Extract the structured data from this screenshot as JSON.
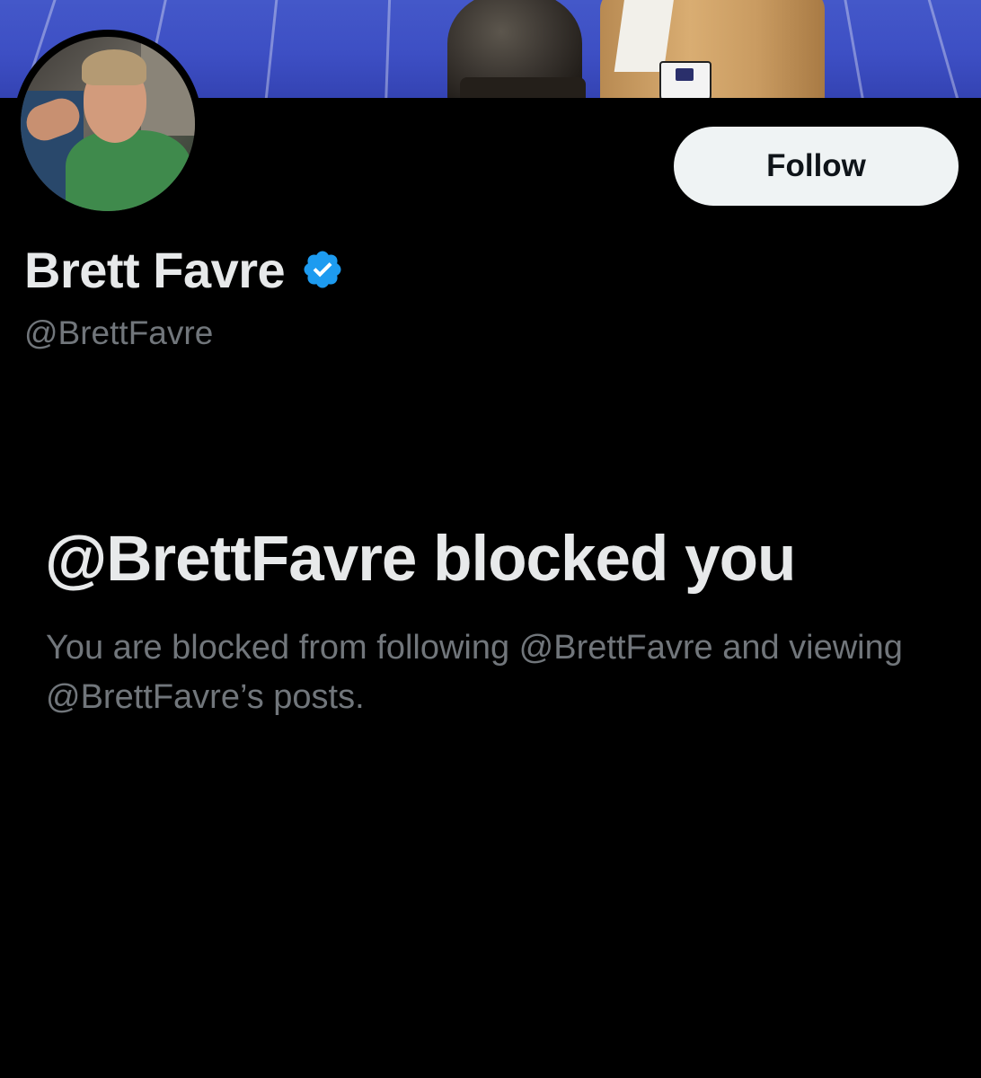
{
  "profile": {
    "display_name": "Brett Favre",
    "handle": "@BrettFavre",
    "verified": true,
    "verified_icon": "verified-badge-icon",
    "verified_color": "#1d9bf0"
  },
  "actions": {
    "follow_label": "Follow"
  },
  "blocked": {
    "title": "@BrettFavre blocked you",
    "description": "You are blocked from following @BrettFavre and viewing @BrettFavre’s posts."
  },
  "colors": {
    "background": "#000000",
    "primary_text": "#e7e9ea",
    "secondary_text": "#71767b",
    "button_bg": "#eff3f4",
    "button_text": "#0f1419"
  }
}
